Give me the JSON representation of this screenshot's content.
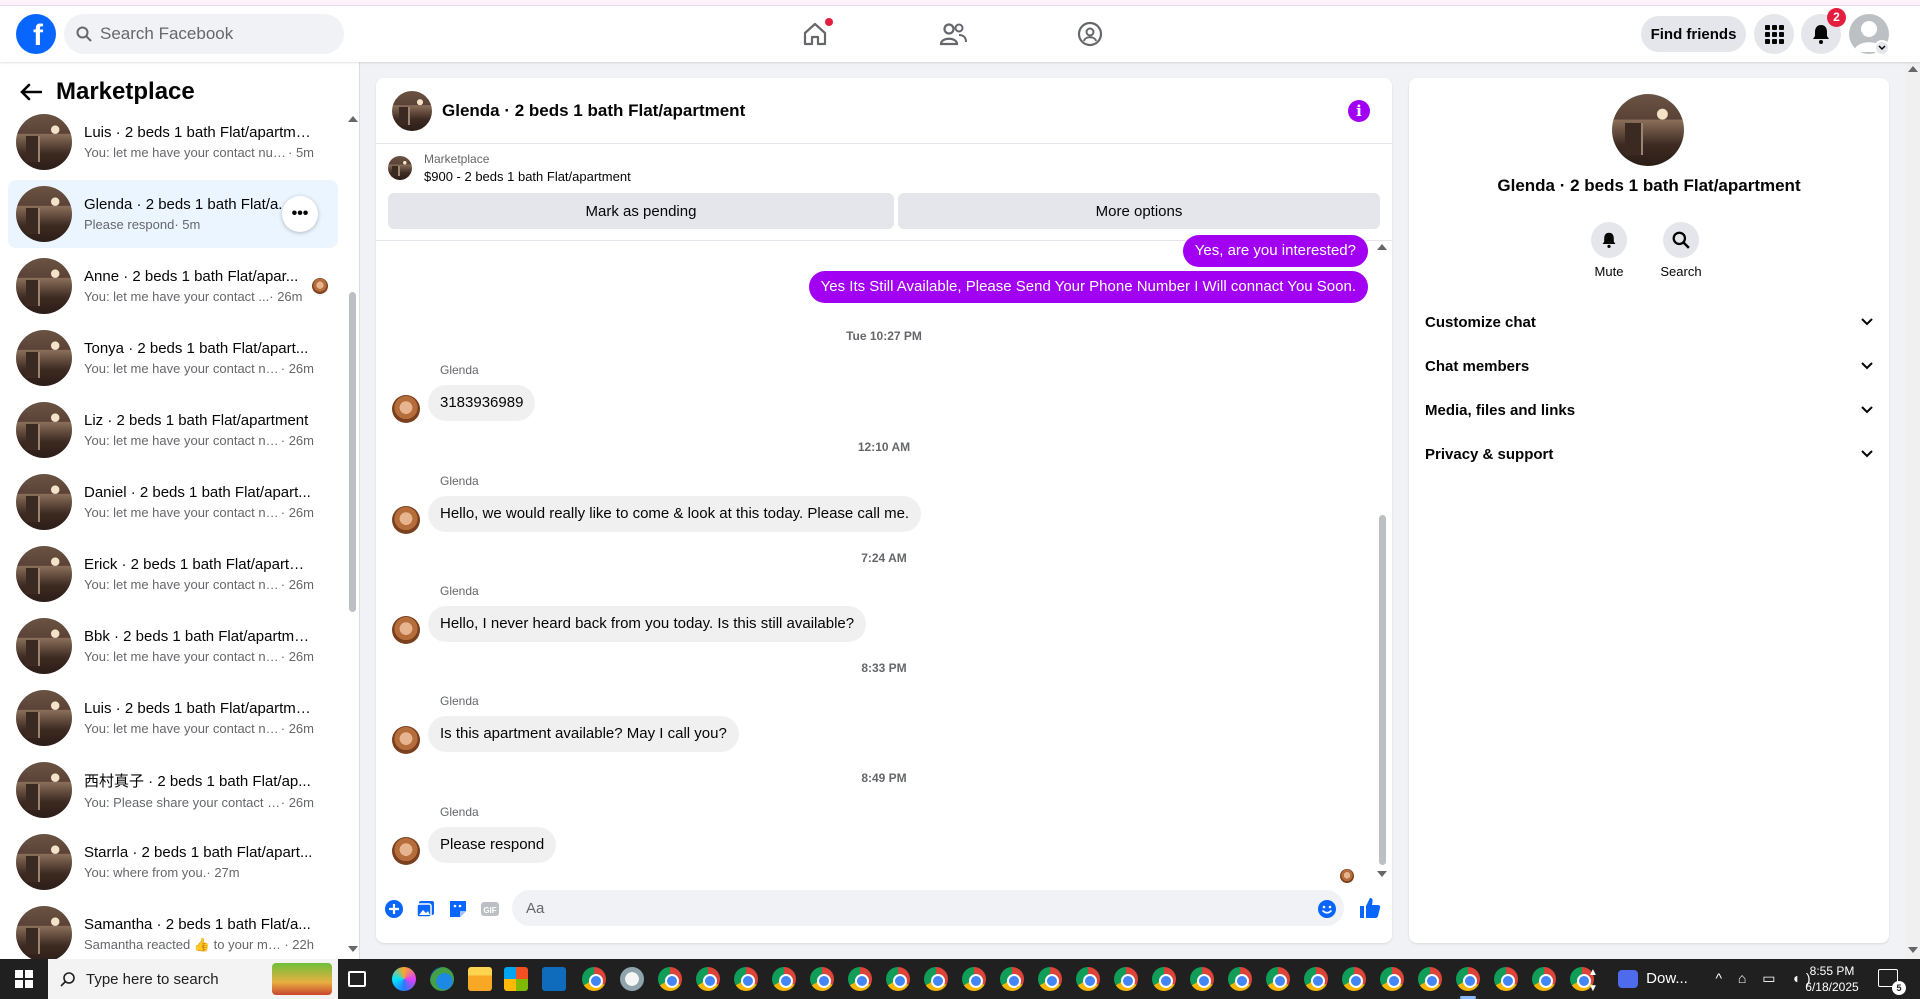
{
  "header": {
    "search_placeholder": "Search Facebook",
    "find_friends": "Find friends",
    "notification_count": "2"
  },
  "sidebar": {
    "title": "Marketplace",
    "conversations": [
      {
        "title": "Luis · 2 beds 1 bath Flat/apartme...",
        "snippet": "You: let me have your contact num...",
        "time": " · 5m"
      },
      {
        "title": "Glenda · 2 beds 1 bath Flat/a...",
        "snippet": "Please respond",
        "time": " · 5m"
      },
      {
        "title": "Anne · 2 beds 1 bath Flat/apar...",
        "snippet": "You: let me have your contact ...",
        "time": " · 26m"
      },
      {
        "title": "Tonya · 2 beds 1 bath Flat/apart...",
        "snippet": "You: let me have your contact nu...",
        "time": " · 26m"
      },
      {
        "title": "Liz · 2 beds 1 bath Flat/apartment",
        "snippet": "You: let me have your contact nu...",
        "time": " · 26m"
      },
      {
        "title": "Daniel · 2 beds 1 bath Flat/apart...",
        "snippet": "You: let me have your contact nu...",
        "time": " · 26m"
      },
      {
        "title": "Erick · 2 beds 1 bath Flat/apartm...",
        "snippet": "You: let me have your contact nu...",
        "time": " · 26m"
      },
      {
        "title": "Bbk · 2 beds 1 bath Flat/apartme...",
        "snippet": "You: let me have your contact nu...",
        "time": " · 26m"
      },
      {
        "title": "Luis · 2 beds 1 bath Flat/apartme...",
        "snippet": "You: let me have your contact nu...",
        "time": " · 26m"
      },
      {
        "title": "西村真子 · 2 beds 1 bath Flat/ap...",
        "snippet": "You: Please share your contact nu...",
        "time": " · 26m"
      },
      {
        "title": "Starrla · 2 beds 1 bath Flat/apart...",
        "snippet": "You: where from you.",
        "time": " · 27m"
      },
      {
        "title": "Samantha · 2 beds 1 bath Flat/a...",
        "snippet": "Samantha reacted 👍 to your me...",
        "time": " · 22h"
      }
    ]
  },
  "chat": {
    "title": "Glenda · 2 beds 1 bath Flat/apartment",
    "listing_label": "Marketplace",
    "listing_price": "$900 - 2 beds 1 bath Flat/apartment",
    "mark_pending": "Mark as pending",
    "more_options": "More options",
    "outgoing": [
      "Yes, are you interested?",
      "Yes Its Still Available, Please Send Your Phone Number I Will connact You Soon."
    ],
    "incoming": [
      {
        "stamp": "Tue 10:27 PM",
        "sender": "Glenda",
        "text": "3183936989"
      },
      {
        "stamp": "12:10 AM",
        "sender": "Glenda",
        "text": "Hello, we would really like to come & look at this today. Please call me."
      },
      {
        "stamp": "7:24 AM",
        "sender": "Glenda",
        "text": "Hello, I never heard back from you today. Is this still available?"
      },
      {
        "stamp": "8:33 PM",
        "sender": "Glenda",
        "text": "Is this apartment available? May I call you?"
      },
      {
        "stamp": "8:49 PM",
        "sender": "Glenda",
        "text": "Please respond"
      }
    ],
    "composer_placeholder": "Aa"
  },
  "details": {
    "title": "Glenda · 2 beds 1 bath Flat/apartment",
    "mute": "Mute",
    "search": "Search",
    "sections": [
      "Customize chat",
      "Chat members",
      "Media, files and links",
      "Privacy & support"
    ]
  },
  "taskbar": {
    "search_placeholder": "Type here to search",
    "pinned_label": "Dow...",
    "time": "8:55 PM",
    "date": "6/18/2025",
    "notification_count": "5"
  },
  "colors": {
    "accent": "#a100f2",
    "facebook_blue": "#0866ff",
    "badge_red": "#e41e3f"
  }
}
